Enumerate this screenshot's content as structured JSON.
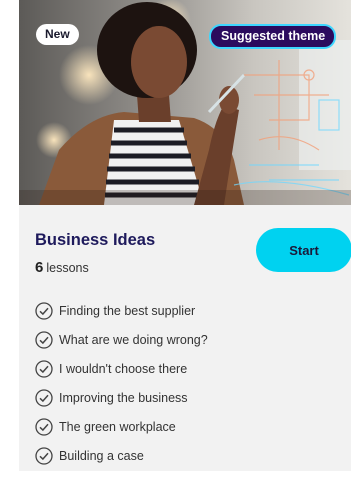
{
  "card": {
    "badge_new": "New",
    "badge_suggested": "Suggested theme",
    "title": "Business Ideas",
    "lesson_count": "6",
    "lesson_unit": "lessons",
    "start_label": "Start",
    "lessons": [
      {
        "label": "Finding the best supplier",
        "icon": "check-circle-icon"
      },
      {
        "label": "What are we doing wrong?",
        "icon": "check-circle-icon"
      },
      {
        "label": "I wouldn't choose there",
        "icon": "check-circle-icon"
      },
      {
        "label": "Improving the business",
        "icon": "check-circle-icon"
      },
      {
        "label": "The green workplace",
        "icon": "check-circle-icon"
      },
      {
        "label": "Building a case",
        "icon": "check-circle-icon"
      }
    ]
  },
  "colors": {
    "card_bg": "#f2f2f2",
    "title": "#1e1a5c",
    "start_button": "#00d2f0",
    "theme_badge_bg": "#2b0b5e",
    "theme_badge_border": "#3dd6ff"
  }
}
